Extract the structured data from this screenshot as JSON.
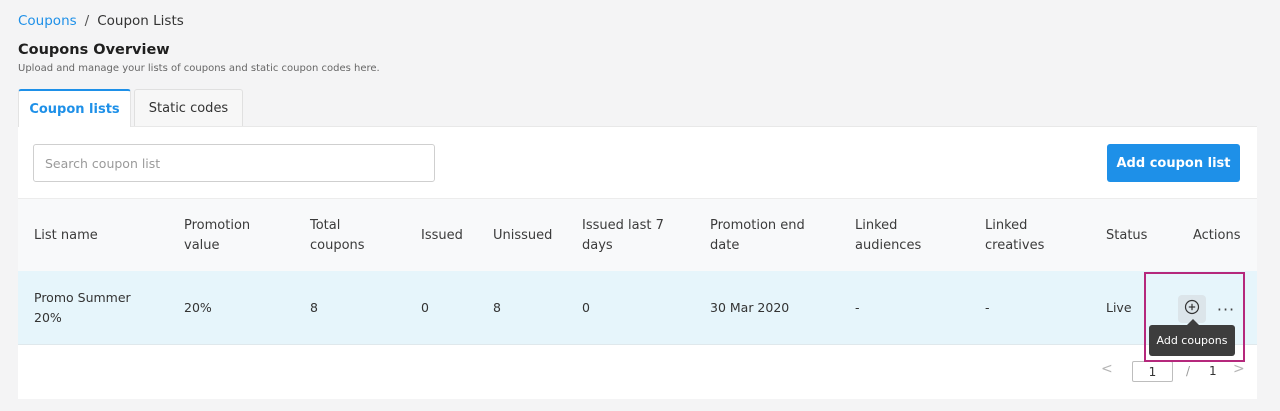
{
  "breadcrumb": {
    "parent": "Coupons",
    "separator": "/",
    "current": "Coupon Lists"
  },
  "header": {
    "title": "Coupons Overview",
    "subtitle": "Upload and manage your lists of coupons and static coupon codes here."
  },
  "tabs": [
    {
      "label": "Coupon lists",
      "active": true
    },
    {
      "label": "Static codes",
      "active": false
    }
  ],
  "search": {
    "placeholder": "Search coupon list",
    "value": ""
  },
  "toolbar": {
    "add_list_label": "Add coupon list"
  },
  "table": {
    "headers": {
      "name": "List name",
      "promo": "Promotion value",
      "total": "Total coupons",
      "issued": "Issued",
      "unissued": "Unissued",
      "last7": "Issued last 7 days",
      "end": "Promotion end date",
      "audiences": "Linked audiences",
      "creatives": "Linked creatives",
      "status": "Status",
      "actions": "Actions"
    },
    "rows": [
      {
        "name": "Promo Summer 20%",
        "promo": "20%",
        "total": "8",
        "issued": "0",
        "unissued": "8",
        "last7": "0",
        "end": "30 Mar 2020",
        "audiences": "-",
        "creatives": "-",
        "status": "Live",
        "actions": [
          {
            "icon": "plus-circle-icon",
            "tooltip": "Add coupons"
          },
          {
            "icon": "more-horizontal-icon",
            "glyph": "···"
          }
        ]
      }
    ]
  },
  "pagination": {
    "prev_glyph": "<",
    "current_page": "1",
    "separator": "/",
    "total_pages": "1",
    "next_glyph": ">"
  },
  "colors": {
    "accent": "#1e90e8",
    "row_highlight": "#e6f5fb",
    "annotation_border": "#b5287c",
    "tooltip_bg": "#3d3d3d"
  }
}
